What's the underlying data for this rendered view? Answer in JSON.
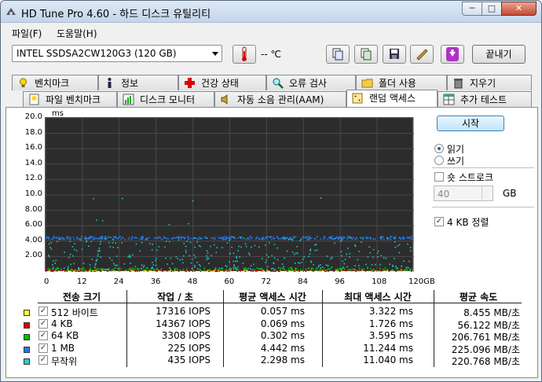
{
  "window": {
    "title": "HD Tune Pro 4.60 - 하드 디스크 유틸리티",
    "min_glyph": "─",
    "max_glyph": "□",
    "close_glyph": "✕"
  },
  "menu": [
    "파일(F)",
    "도움말(H)"
  ],
  "toolbar": {
    "drive": "INTEL SSDSA2CW120G3 (120 GB)",
    "temperature": "-- ℃",
    "exit_label": "끝내기"
  },
  "tabs_top": [
    "벤치마크",
    "정보",
    "건강 상태",
    "오류 검사",
    "폴더 사용",
    "지우기"
  ],
  "tabs_bottom": [
    "파일 벤치마크",
    "디스크 모니터",
    "자동 소음 관리(AAM)",
    "랜덤 액세스",
    "추가 테스트"
  ],
  "active_tab": "랜덤 액세스",
  "chart": {
    "unit": "ms",
    "y_ticks": [
      "20.0",
      "18.0",
      "16.0",
      "14.0",
      "12.0",
      "10.0",
      "8.00",
      "6.00",
      "4.00",
      "2.00"
    ],
    "x_ticks": [
      "0",
      "12",
      "24",
      "36",
      "48",
      "60",
      "72",
      "84",
      "96",
      "108",
      "120GB"
    ]
  },
  "chart_data": {
    "type": "scatter",
    "ylabel": "ms",
    "xlim": [
      0,
      120
    ],
    "ylim": [
      0,
      20
    ],
    "x_ticks": [
      0,
      12,
      24,
      36,
      48,
      60,
      72,
      84,
      96,
      108,
      120
    ],
    "y_ticks": [
      2,
      4,
      6,
      8,
      10,
      12,
      14,
      16,
      18,
      20
    ],
    "series": [
      {
        "name": "512 바이트",
        "color": "#e8e800",
        "band": [
          0.0,
          0.2
        ]
      },
      {
        "name": "4 KB",
        "color": "#e00000",
        "band": [
          0.0,
          0.2
        ]
      },
      {
        "name": "64 KB",
        "color": "#00c000",
        "band": [
          0.2,
          0.5
        ]
      },
      {
        "name": "1 MB",
        "color": "#2878e0",
        "band": [
          4.2,
          4.6
        ]
      },
      {
        "name": "무작위",
        "color": "#20c8c8",
        "band": [
          0.3,
          4.5
        ]
      }
    ]
  },
  "controls": {
    "start_label": "시작",
    "read_label": "읽기",
    "write_label": "쓰기",
    "mode": "read",
    "short_stroke_label": "숏 스트로크",
    "short_stroke_checked": false,
    "short_stroke_value": "40",
    "gb_label": "GB",
    "align_label": "4 KB 정렬",
    "align_checked": true
  },
  "table": {
    "headers": [
      "전송 크기",
      "작업 / 초",
      "평균 액세스 시간",
      "최대 액세스 시간",
      "평균 속도"
    ],
    "rows": [
      {
        "label": "512 바이트",
        "color": "#ffff40",
        "ops": "17316 IOPS",
        "avg": "0.057 ms",
        "max": "3.322 ms",
        "speed": "8.455 MB/초"
      },
      {
        "label": "4 KB",
        "color": "#e00000",
        "ops": "14367 IOPS",
        "avg": "0.069 ms",
        "max": "1.726 ms",
        "speed": "56.122 MB/초"
      },
      {
        "label": "64 KB",
        "color": "#00c000",
        "ops": "3308 IOPS",
        "avg": "0.302 ms",
        "max": "3.595 ms",
        "speed": "206.761 MB/초"
      },
      {
        "label": "1 MB",
        "color": "#2878e0",
        "ops": "225 IOPS",
        "avg": "4.442 ms",
        "max": "11.244 ms",
        "speed": "225.096 MB/초"
      },
      {
        "label": "무작위",
        "color": "#20d0d0",
        "ops": "435 IOPS",
        "avg": "2.298 ms",
        "max": "11.040 ms",
        "speed": "220.768 MB/초"
      }
    ]
  }
}
